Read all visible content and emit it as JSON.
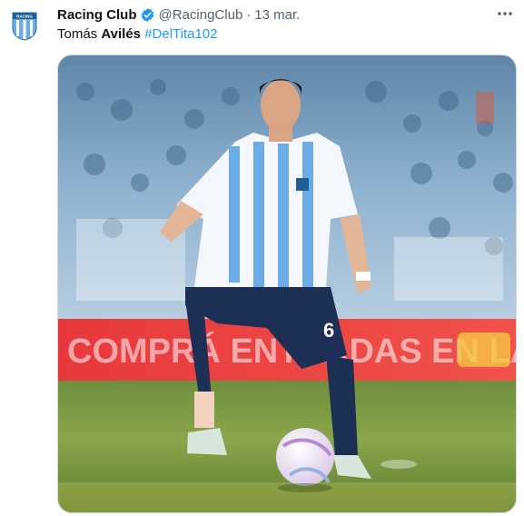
{
  "tweet": {
    "display_name": "Racing Club",
    "handle": "@RacingClub",
    "separator": "·",
    "date": "13 mar.",
    "text_plain": "Tomás ",
    "text_bold": "Avilés",
    "text_space": " ",
    "hashtag": "#DelTita102"
  },
  "avatar": {
    "badge_text": "RACING"
  },
  "media": {
    "banner_text": "COMPRÁ ENTRADAS EN LA APP",
    "jersey_number": "6"
  },
  "icons": {
    "verified": "verified-badge-icon",
    "more": "more-options-icon"
  },
  "colors": {
    "brand_blue": "#1d9bf0",
    "racing_light_blue": "#6cace4",
    "text_primary": "#0f1419",
    "text_muted": "#536471"
  }
}
